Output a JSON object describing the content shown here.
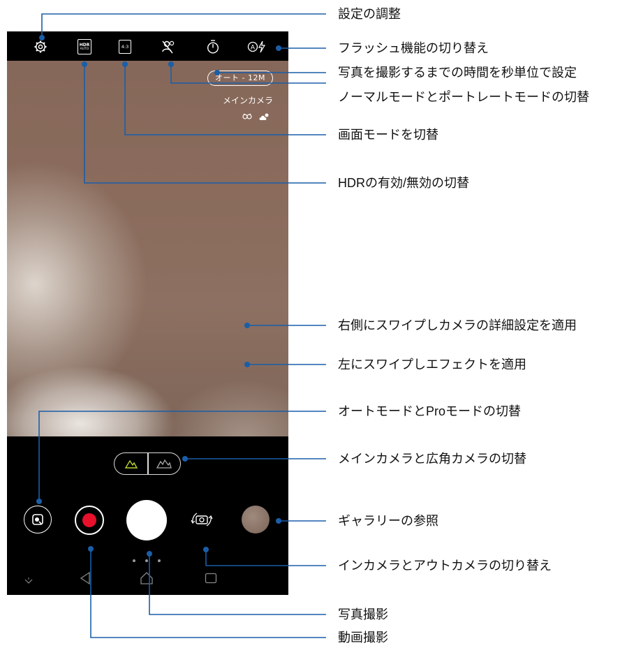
{
  "viewfinder": {
    "resolution_label": "オート - 12M",
    "camera_label": "メインカメラ"
  },
  "topbar_icons": [
    "gear-icon",
    "hdr-auto-icon",
    "aspect-ratio-icon",
    "portrait-off-icon",
    "timer-icon",
    "flash-auto-icon"
  ],
  "topbar_texts": {
    "hdr_top": "HDR",
    "hdr_bottom": "AUTO",
    "aspect": "4:3"
  },
  "colors": {
    "callout_line": "#1a5ea8",
    "record": "#e8102b",
    "lens_active": "#b7d435"
  },
  "annotations": {
    "settings": "設定の調整",
    "flash": "フラッシュ機能の切り替え",
    "timer": "写真を撮影するまでの時間を秒単位で設定",
    "portrait": "ノーマルモードとポートレートモードの切替",
    "screen_mode": "画面モードを切替",
    "hdr": "HDRの有効/無効の切替",
    "swipe_right": "右側にスワイプしカメラの詳細設定を適用",
    "swipe_left": "左にスワイプしエフェクトを適用",
    "auto_pro": "オートモードとProモードの切替",
    "lens": "メインカメラと広角カメラの切替",
    "gallery": "ギャラリーの参照",
    "front_back": "インカメラとアウトカメラの切り替え",
    "photo": "写真撮影",
    "video": "動画撮影"
  }
}
